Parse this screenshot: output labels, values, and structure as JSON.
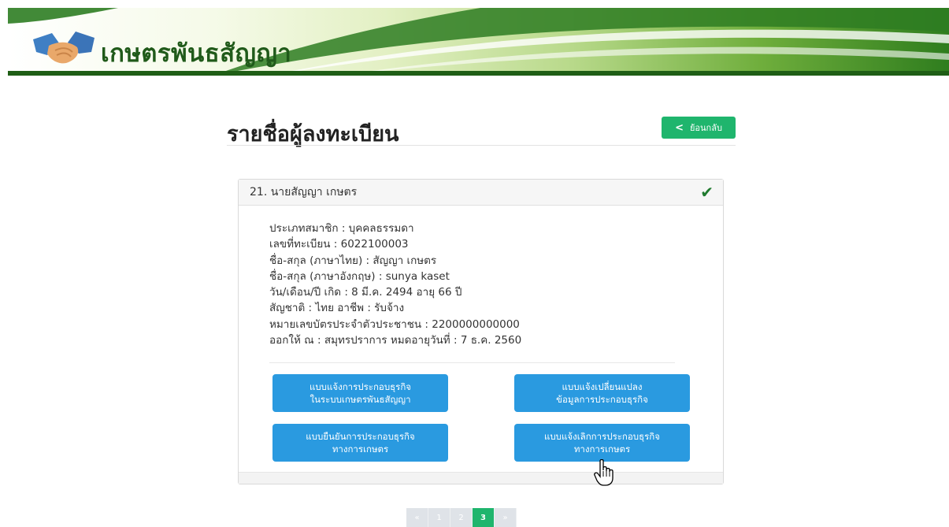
{
  "header": {
    "app_title": "เกษตรพันธสัญญา"
  },
  "page": {
    "title": "รายชื่อผู้ลงทะเบียน",
    "back_label": "ย้อนกลับ"
  },
  "card": {
    "heading": "21. นายสัญญา เกษตร",
    "info_lines": [
      "ประเภทสมาชิก : บุคคลธรรมดา",
      "เลขที่ทะเบียน : 6022100003",
      "ชื่อ-สกุล (ภาษาไทย) : สัญญา เกษตร",
      "ชื่อ-สกุล (ภาษาอังกฤษ) : sunya kaset",
      "วัน/เดือน/ปี เกิด : 8 มี.ค. 2494 อายุ 66 ปี",
      "สัญชาติ : ไทย อาชีพ : รับจ้าง",
      "หมายเลขบัตรประจำตัวประชาชน : 2200000000000",
      "ออกให้ ณ : สมุทรปราการ หมดอายุวันที่ : 7 ธ.ค. 2560"
    ],
    "actions": [
      {
        "line1": "แบบแจ้งการประกอบธุรกิจ",
        "line2": "ในระบบเกษตรพันธสัญญา"
      },
      {
        "line1": "แบบแจ้งเปลี่ยนแปลง",
        "line2": "ข้อมูลการประกอบธุรกิจ"
      },
      {
        "line1": "แบบยืนยันการประกอบธุรกิจ",
        "line2": "ทางการเกษตร"
      },
      {
        "line1": "แบบแจ้งเลิกการประกอบธุรกิจ",
        "line2": "ทางการเกษตร"
      }
    ]
  },
  "pagination": {
    "prev": "«",
    "pages": [
      "1",
      "2",
      "3"
    ],
    "active": "3",
    "next": "»"
  },
  "colors": {
    "primary_green": "#1fb56d",
    "action_blue": "#2a9ae0",
    "check_green": "#1f7a2e"
  },
  "icons": {
    "back": "chevron-left-icon",
    "verified": "check-icon",
    "cursor": "hand-pointer-icon",
    "logo": "handshake-logo"
  }
}
